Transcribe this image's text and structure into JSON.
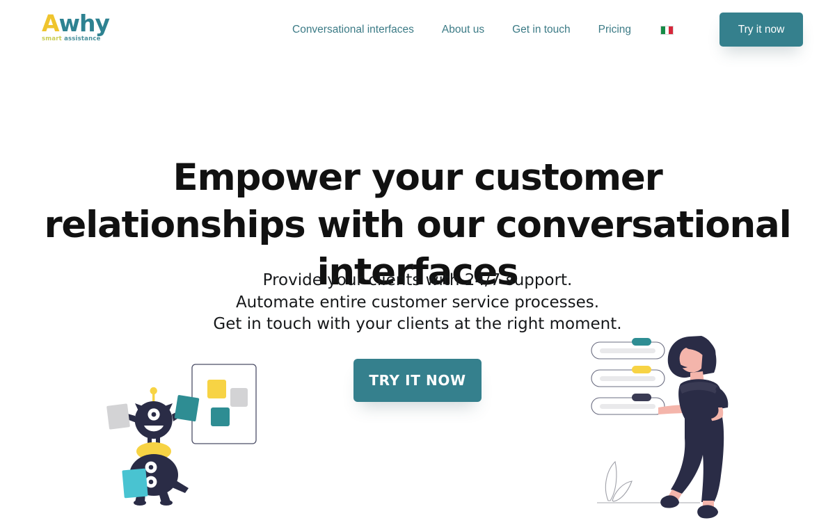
{
  "brand": {
    "logo_a": "A",
    "logo_why": "why",
    "tagline_smart": "smart",
    "tagline_assistance": "assistance",
    "color_yellow": "#EFC42E",
    "color_teal": "#2E8291",
    "color_tag_smart": "#C9CC53",
    "color_tag_assistance": "#49909B"
  },
  "header": {
    "nav": [
      {
        "label": "Conversational interfaces",
        "name": "nav-conversational-interfaces"
      },
      {
        "label": "About us",
        "name": "nav-about-us"
      },
      {
        "label": "Get in touch",
        "name": "nav-get-in-touch"
      },
      {
        "label": "Pricing",
        "name": "nav-pricing"
      }
    ],
    "language": {
      "icon": "italian-flag-icon",
      "country": "Italy",
      "colors": [
        "#168B46",
        "#FFFFFF",
        "#D7273B"
      ]
    },
    "cta_label": "Try it now",
    "cta_color": "#35808D",
    "nav_text_color": "#3C7B86"
  },
  "hero": {
    "headline_line1": "Empower your customer relationships with",
    "headline_line2": "our conversational interfaces",
    "subhead_line1": "Provide your clients with 24/7 support.",
    "subhead_line2": "Automate entire customer service processes.",
    "subhead_line3": "Get in touch with your clients at the right moment.",
    "cta_label": "TRY IT NOW",
    "cta_color": "#35808D",
    "headline_color": "#111111"
  },
  "illustration_left": {
    "name": "robot-characters-illustration",
    "description": "Two stacked dark navy robot mascots holding cards beside a white panel with colored squares",
    "robot_color": "#2A2C46",
    "accent_yellow": "#F7D344",
    "accent_teal": "#2E8D93",
    "accent_cyan": "#49C3D1",
    "accent_grey": "#D3D3D5",
    "panel_squares": [
      "#F7D344",
      "#D3D3D5",
      "#2E8D93"
    ]
  },
  "illustration_right": {
    "name": "woman-with-task-list-illustration",
    "description": "Woman figure reaching toward three rounded list bars with colored tabs",
    "figure_color": "#2A2C46",
    "skin_color": "#F4B5AB",
    "bars": [
      {
        "tab_color": "#2E8D93",
        "name": "list-bar-1"
      },
      {
        "tab_color": "#F7D344",
        "name": "list-bar-2"
      },
      {
        "tab_color": "#3A3B54",
        "name": "list-bar-3"
      }
    ]
  }
}
